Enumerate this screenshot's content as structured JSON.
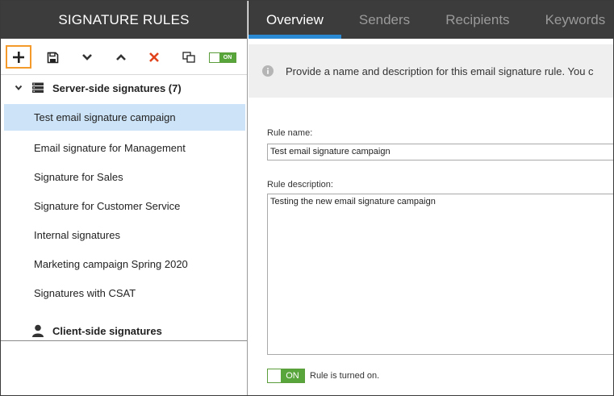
{
  "left_panel": {
    "title": "SIGNATURE RULES",
    "toolbar": {
      "add_icon": "plus-icon",
      "save_icon": "save-icon",
      "move_down_icon": "chevron-down-icon",
      "move_up_icon": "chevron-up-icon",
      "delete_icon": "x-icon",
      "duplicate_icon": "copy-icon",
      "toggle_label": "ON"
    },
    "server_group": {
      "label": "Server-side signatures (7)",
      "expanded": true
    },
    "items": [
      {
        "label": "Test email signature campaign",
        "selected": true
      },
      {
        "label": "Email signature for Management",
        "selected": false
      },
      {
        "label": "Signature for Sales",
        "selected": false
      },
      {
        "label": "Signature for Customer Service",
        "selected": false
      },
      {
        "label": "Internal signatures",
        "selected": false
      },
      {
        "label": "Marketing campaign Spring 2020",
        "selected": false
      },
      {
        "label": "Signatures with CSAT",
        "selected": false
      }
    ],
    "client_group": {
      "label": "Client-side signatures"
    }
  },
  "right_panel": {
    "tabs": [
      {
        "label": "Overview",
        "active": true
      },
      {
        "label": "Senders",
        "active": false
      },
      {
        "label": "Recipients",
        "active": false
      },
      {
        "label": "Keywords",
        "active": false
      }
    ],
    "info_text": "Provide a name and description for this email signature rule. You c",
    "rule_name_label": "Rule name:",
    "rule_name_value": "Test email signature campaign",
    "rule_description_label": "Rule description:",
    "rule_description_value": "Testing the new email signature campaign",
    "toggle_label": "ON",
    "toggle_text": "Rule is turned on."
  },
  "colors": {
    "header_bg": "#3c3c3c",
    "accent_blue": "#2a8ad4",
    "selection_bg": "#cde3f7",
    "toggle_green": "#58a53b",
    "add_button_border": "#f39a2b",
    "delete_red": "#e0431b"
  }
}
